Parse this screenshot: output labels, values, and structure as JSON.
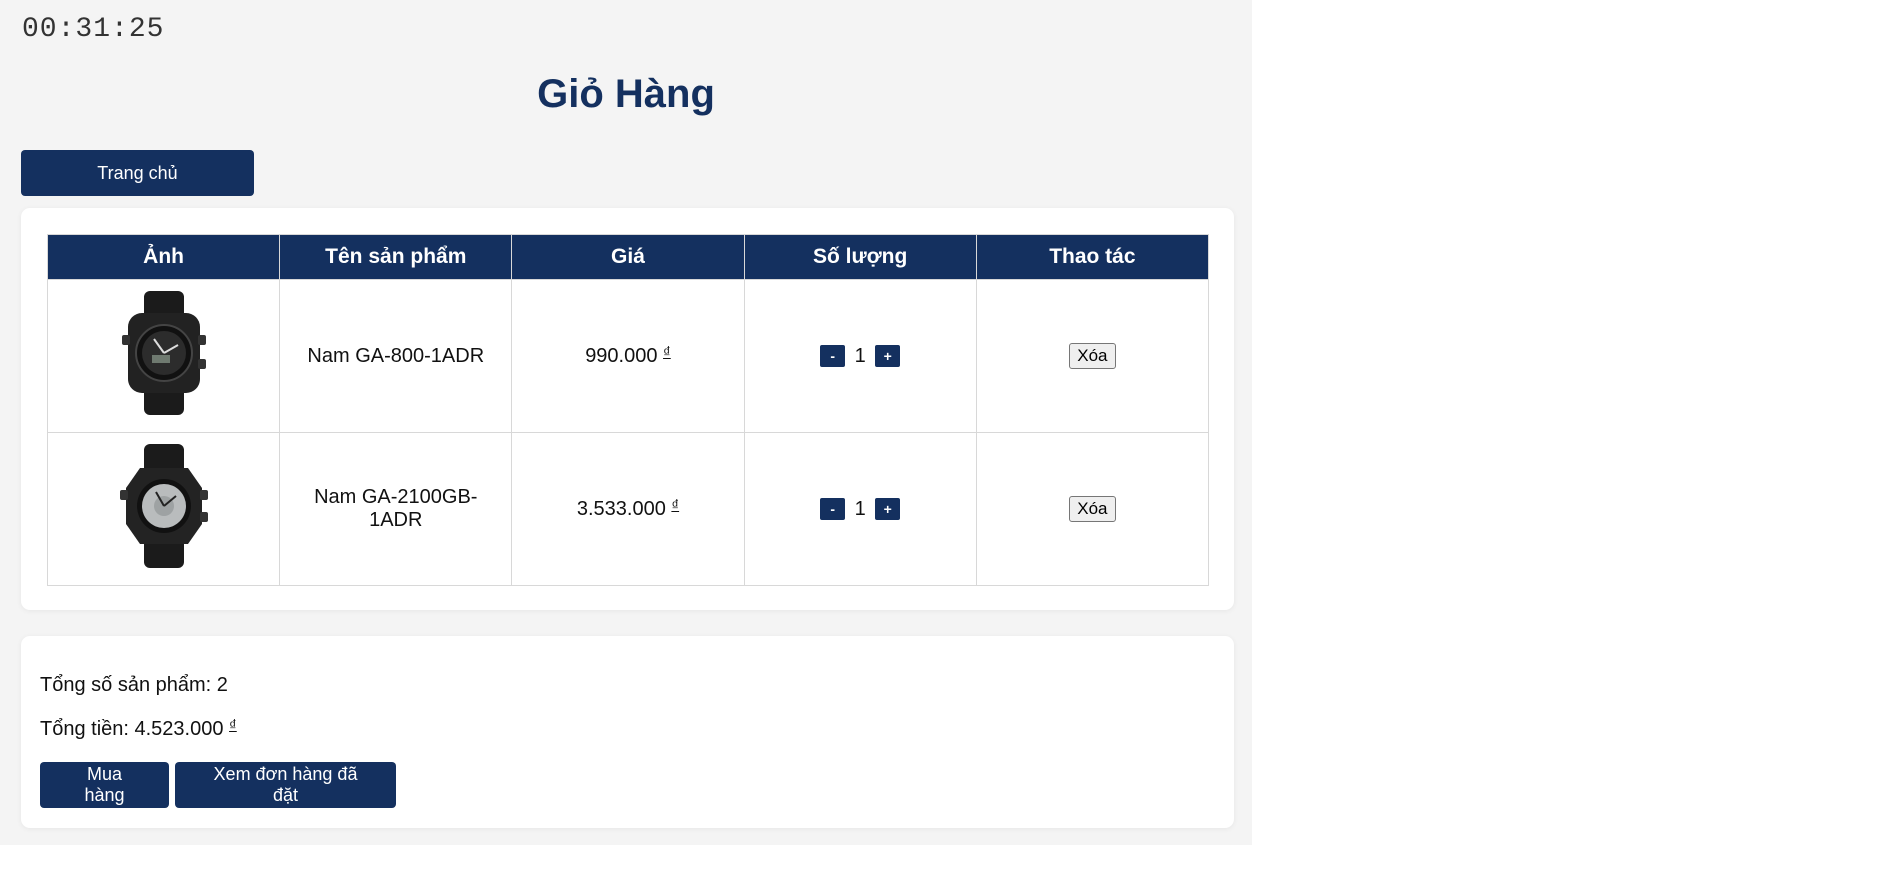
{
  "clock": "00:31:25",
  "page_title": "Giỏ Hàng",
  "home_button": "Trang chủ",
  "table": {
    "headers": [
      "Ảnh",
      "Tên sản phẩm",
      "Giá",
      "Số lượng",
      "Thao tác"
    ],
    "rows": [
      {
        "image_icon": "watch-black-ga800-icon",
        "name": "Nam GA-800-1ADR",
        "price": "990.000",
        "currency": "₫",
        "quantity": "1",
        "minus": "-",
        "plus": "+",
        "delete": "Xóa"
      },
      {
        "image_icon": "watch-black-silver-ga2100-icon",
        "name": "Nam GA-2100GB-1ADR",
        "price": "3.533.000",
        "currency": "₫",
        "quantity": "1",
        "minus": "-",
        "plus": "+",
        "delete": "Xóa"
      }
    ]
  },
  "summary": {
    "total_items": "Tổng số sản phẩm: 2",
    "total_price_label": "Tổng tiền: 4.523.000",
    "total_price_currency": "₫",
    "buy_button": "Mua hàng",
    "orders_button": "Xem đơn hàng đã đặt"
  },
  "colors": {
    "primary": "#14305f",
    "page_background": "#f4f4f4",
    "card_background": "#ffffff"
  }
}
